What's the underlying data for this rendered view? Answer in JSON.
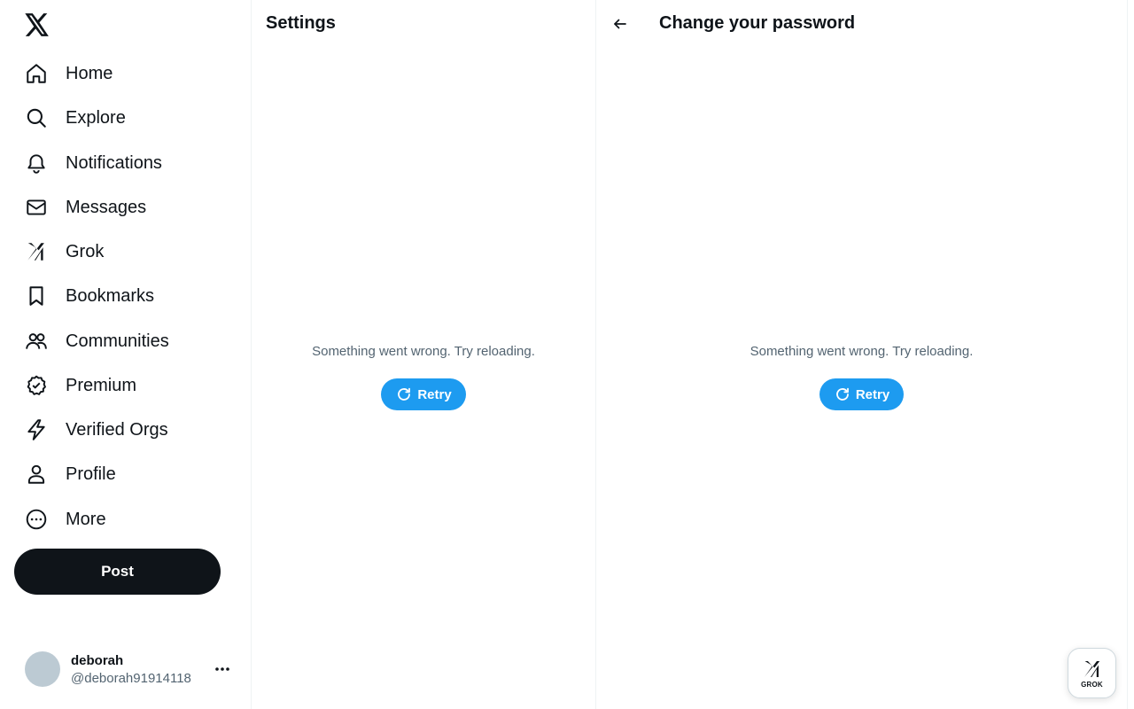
{
  "nav": {
    "items": [
      {
        "label": "Home",
        "icon": "home-icon"
      },
      {
        "label": "Explore",
        "icon": "search-icon"
      },
      {
        "label": "Notifications",
        "icon": "bell-icon"
      },
      {
        "label": "Messages",
        "icon": "envelope-icon"
      },
      {
        "label": "Grok",
        "icon": "grok-icon"
      },
      {
        "label": "Bookmarks",
        "icon": "bookmark-icon"
      },
      {
        "label": "Communities",
        "icon": "people-icon"
      },
      {
        "label": "Premium",
        "icon": "verified-badge-icon"
      },
      {
        "label": "Verified Orgs",
        "icon": "lightning-icon"
      },
      {
        "label": "Profile",
        "icon": "person-icon"
      },
      {
        "label": "More",
        "icon": "more-circle-icon"
      }
    ],
    "post_label": "Post"
  },
  "account": {
    "name": "deborah",
    "handle": "@deborah91914118"
  },
  "settings": {
    "title": "Settings",
    "error_message": "Something went wrong. Try reloading.",
    "retry_label": "Retry"
  },
  "detail": {
    "title": "Change your password",
    "error_message": "Something went wrong. Try reloading.",
    "retry_label": "Retry"
  },
  "grok_fab": {
    "label": "GROK"
  },
  "colors": {
    "accent": "#1d9bf0",
    "text_primary": "#0f1419",
    "text_secondary": "#536471"
  }
}
